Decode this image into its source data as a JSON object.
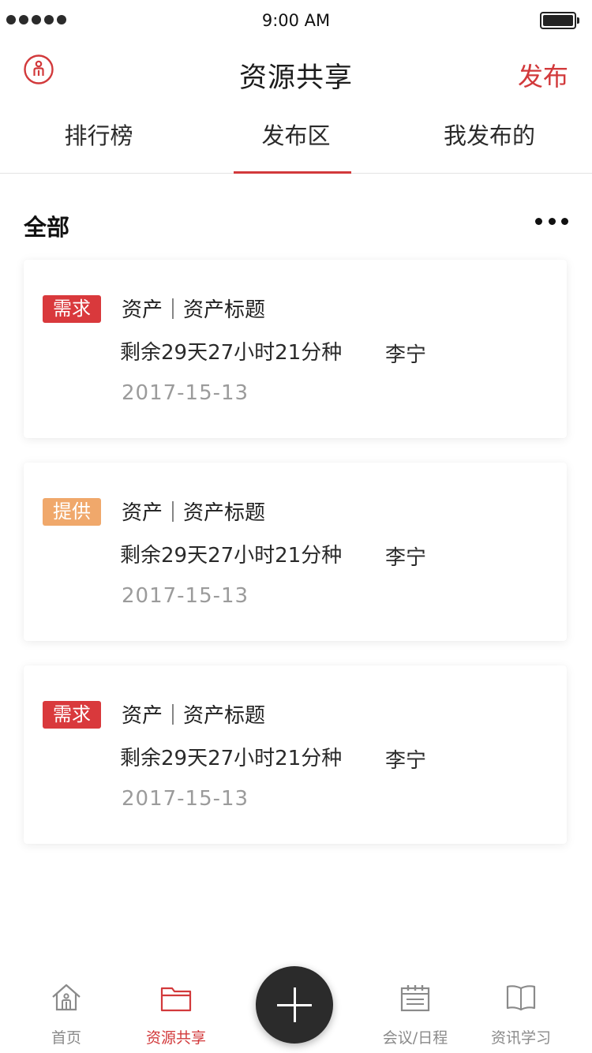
{
  "status_bar": {
    "time": "9:00 AM"
  },
  "nav": {
    "title": "资源共享",
    "publish_label": "发布"
  },
  "tabs": [
    {
      "label": "排行榜",
      "active": false
    },
    {
      "label": "发布区",
      "active": true
    },
    {
      "label": "我发布的",
      "active": false
    }
  ],
  "section": {
    "title": "全部"
  },
  "cards": [
    {
      "tag": "需求",
      "tag_color": "#d9393c",
      "title": "资产｜资产标题",
      "remaining": "剩余29天27小时21分种",
      "author": "李宁",
      "date": "2017-15-13"
    },
    {
      "tag": "提供",
      "tag_color": "#f0a86b",
      "title": "资产｜资产标题",
      "remaining": "剩余29天27小时21分种",
      "author": "李宁",
      "date": "2017-15-13"
    },
    {
      "tag": "需求",
      "tag_color": "#d9393c",
      "title": "资产｜资产标题",
      "remaining": "剩余29天27小时21分种",
      "author": "李宁",
      "date": "2017-15-13"
    }
  ],
  "tabbar": {
    "items": [
      {
        "label": "首页",
        "icon": "home-icon",
        "active": false
      },
      {
        "label": "资源共享",
        "icon": "folder-icon",
        "active": true
      },
      {
        "label": "会议/日程",
        "icon": "calendar-icon",
        "active": false
      },
      {
        "label": "资讯学习",
        "icon": "book-icon",
        "active": false
      }
    ],
    "fab_icon": "plus-icon"
  },
  "colors": {
    "accent": "#d2393b",
    "demand_tag": "#d9393c",
    "supply_tag": "#f0a86b",
    "fab": "#2b2b2b"
  }
}
